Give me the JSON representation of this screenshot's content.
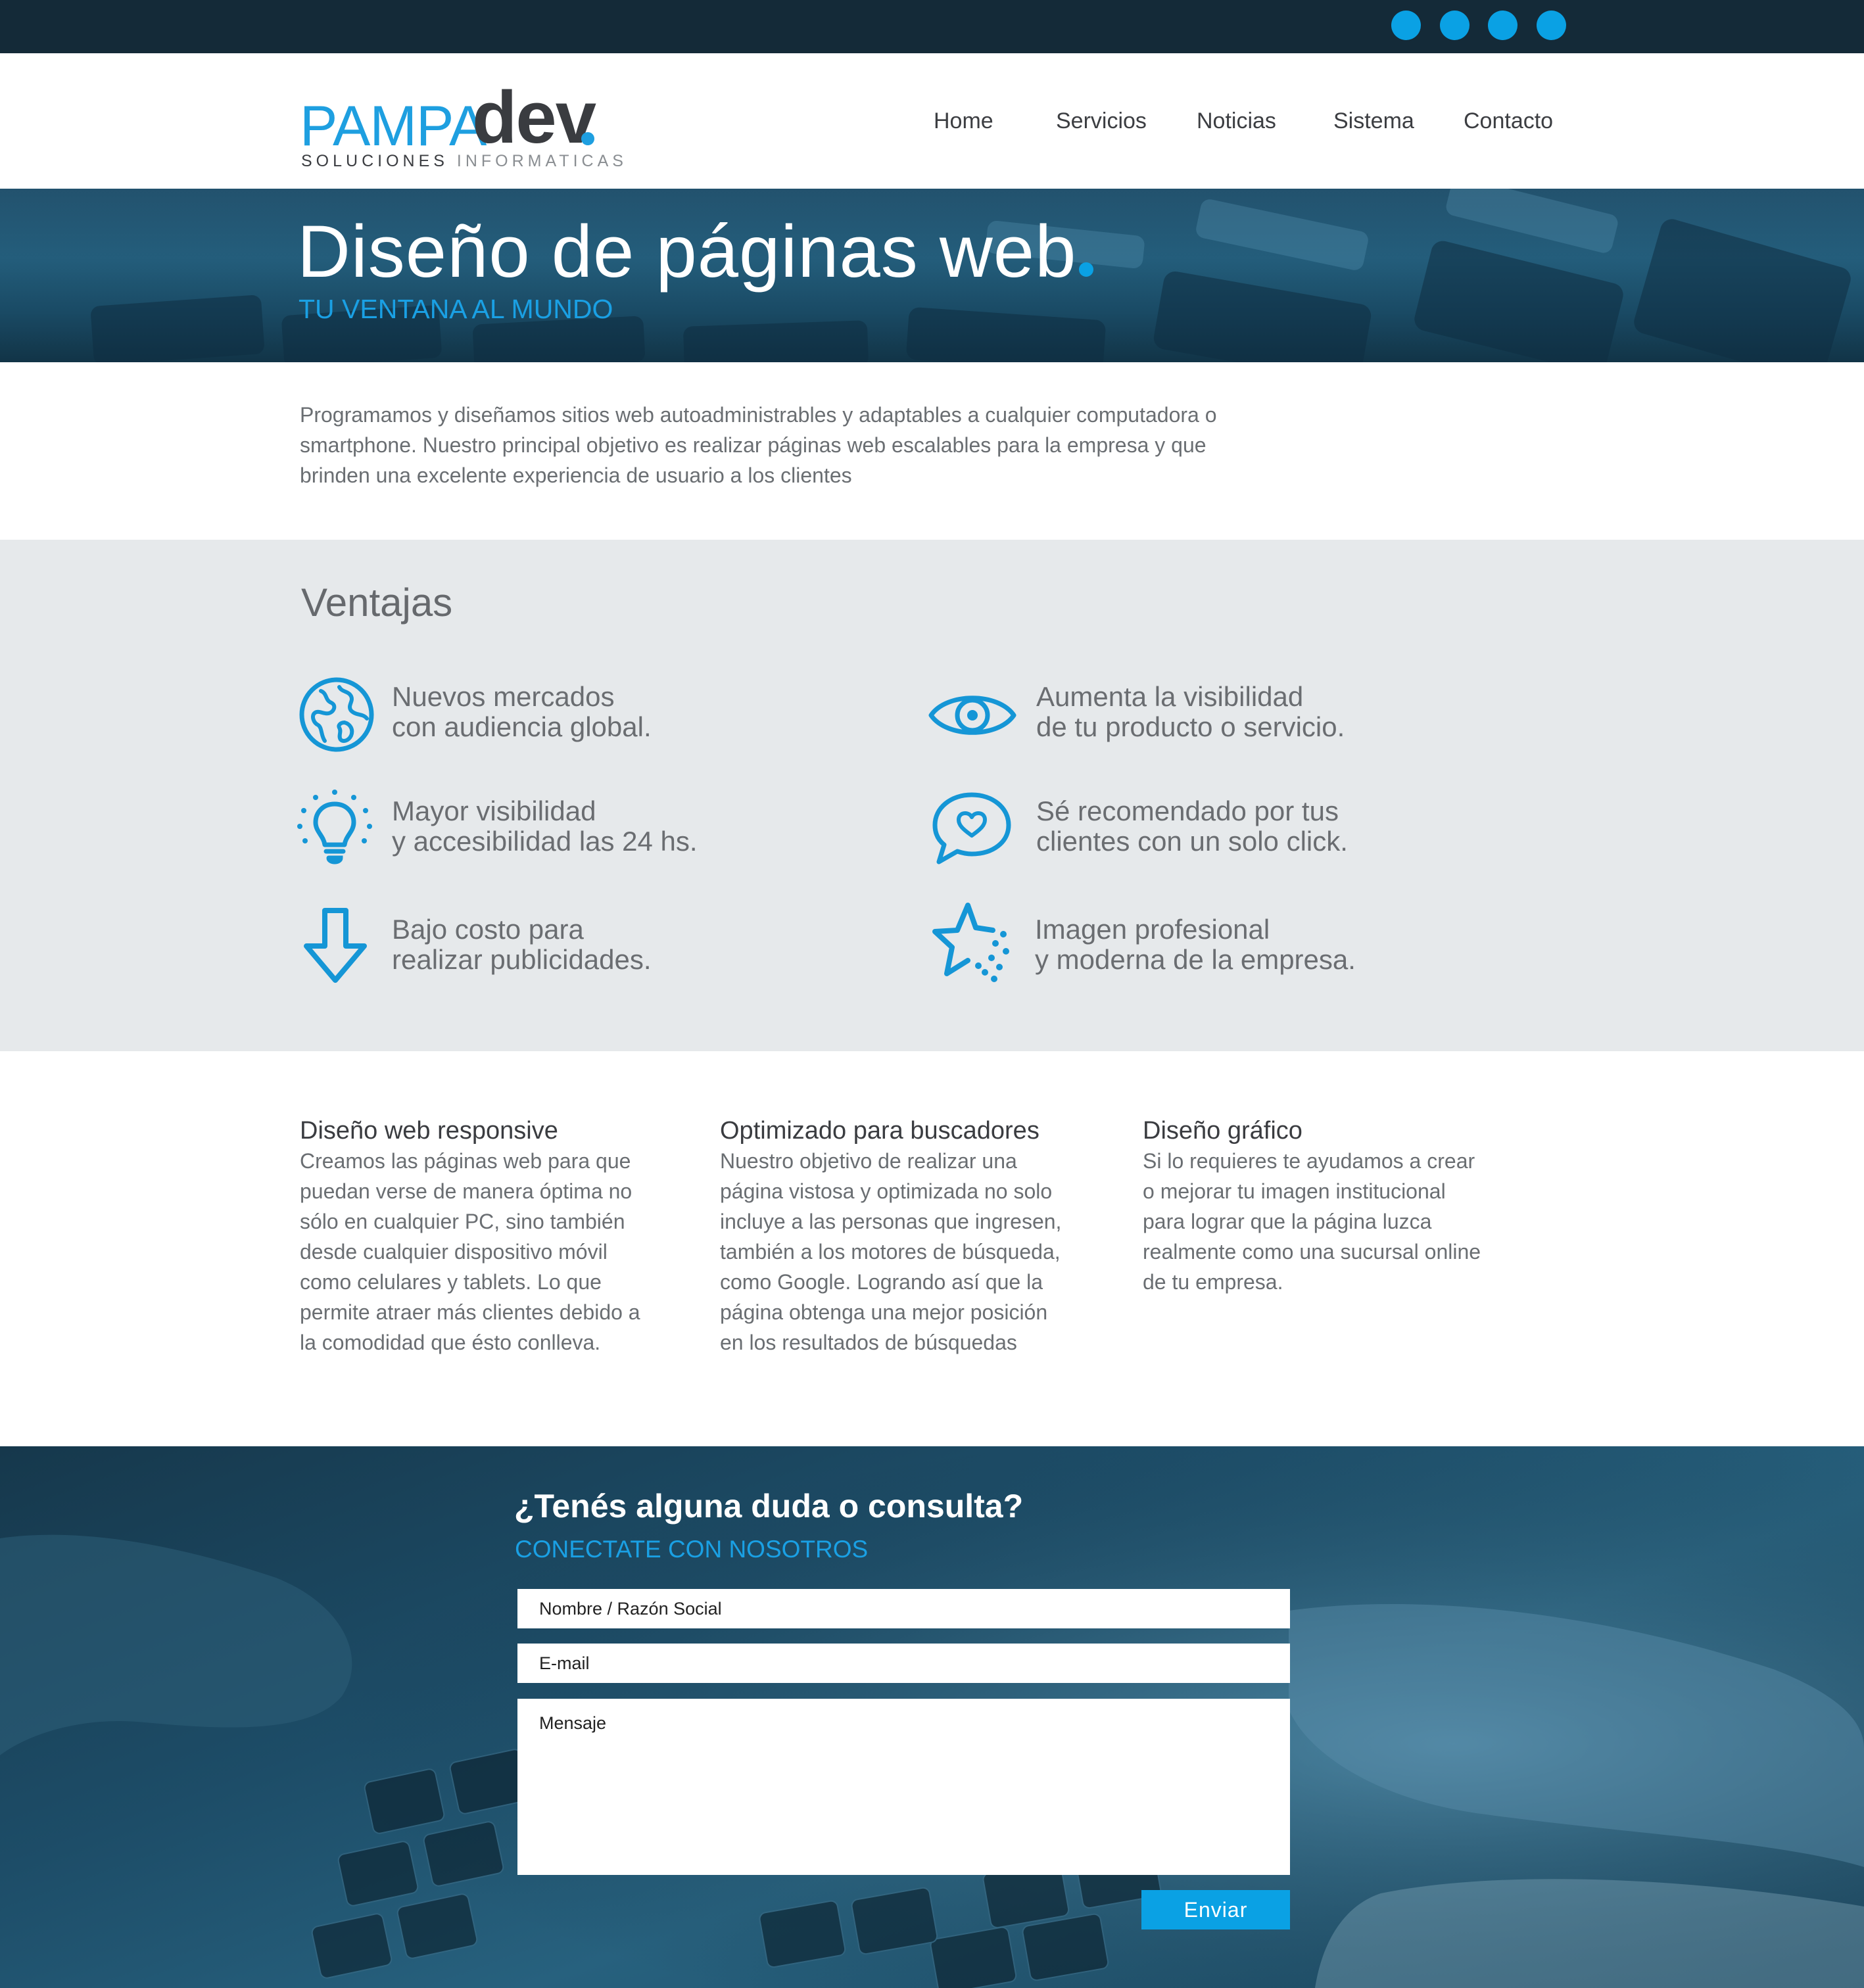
{
  "topbar": {
    "social_icons": [
      "social-icon-1",
      "social-icon-2",
      "social-icon-3",
      "social-icon-4"
    ],
    "accent": "#0aa1e4",
    "background": "#142a38"
  },
  "logo": {
    "wordmark_light": "PAMPA",
    "wordmark_bold": "dev",
    "tagline_dark": "SOLUCIONES",
    "tagline_light": "INFORMATICAS"
  },
  "nav": {
    "items": [
      "Home",
      "Servicios",
      "Noticias",
      "Sistema",
      "Contacto"
    ]
  },
  "hero": {
    "title": "Diseño de páginas web",
    "subtitle": "TU VENTANA AL MUNDO"
  },
  "intro": {
    "text": "Programamos y diseñamos sitios web autoadministrables y adaptables a cualquier computadora o smartphone. Nuestro principal objetivo es realizar páginas web escalables para la empresa y que brinden una excelente experiencia de usuario a los clientes"
  },
  "ventajas": {
    "title": "Ventajas",
    "items": [
      {
        "icon": "globe-icon",
        "text": "Nuevos mercados\ncon audiencia global."
      },
      {
        "icon": "eye-icon",
        "text": "Aumenta la visibilidad\nde tu producto o servicio."
      },
      {
        "icon": "lightbulb-icon",
        "text": "Mayor visibilidad\ny accesibilidad las 24 hs."
      },
      {
        "icon": "chat-heart-icon",
        "text": "Sé recomendado por tus\nclientes con un solo click."
      },
      {
        "icon": "arrow-down-icon",
        "text": "Bajo costo para\nrealizar publicidades."
      },
      {
        "icon": "star-icon",
        "text": "Imagen profesional\ny moderna de la empresa."
      }
    ]
  },
  "services": [
    {
      "title": "Diseño web responsive",
      "body": "Creamos las páginas web para que puedan verse de manera óptima no sólo en cualquier PC, sino también desde cualquier dispositivo móvil como celulares y tablets. Lo que permite atraer más clientes debido a la comodidad que ésto conlleva."
    },
    {
      "title": "Optimizado para buscadores",
      "body": "Nuestro objetivo de realizar una página vistosa y optimizada no solo incluye a las personas que ingresen, también a los motores de búsqueda, como Google. Logrando así que la página obtenga una mejor posición en los resultados de búsquedas"
    },
    {
      "title": "Diseño gráfico",
      "body": "Si lo requieres te ayudamos a crear o mejorar tu imagen institucional para lograr que la página luzca realmente como una sucursal online de tu empresa."
    }
  ],
  "contact": {
    "title": "¿Tenés alguna duda o consulta?",
    "subtitle": "CONECTATE CON NOSOTROS",
    "name_placeholder": "Nombre / Razón Social",
    "email_placeholder": "E-mail",
    "message_placeholder": "Mensaje",
    "send_label": "Enviar"
  }
}
